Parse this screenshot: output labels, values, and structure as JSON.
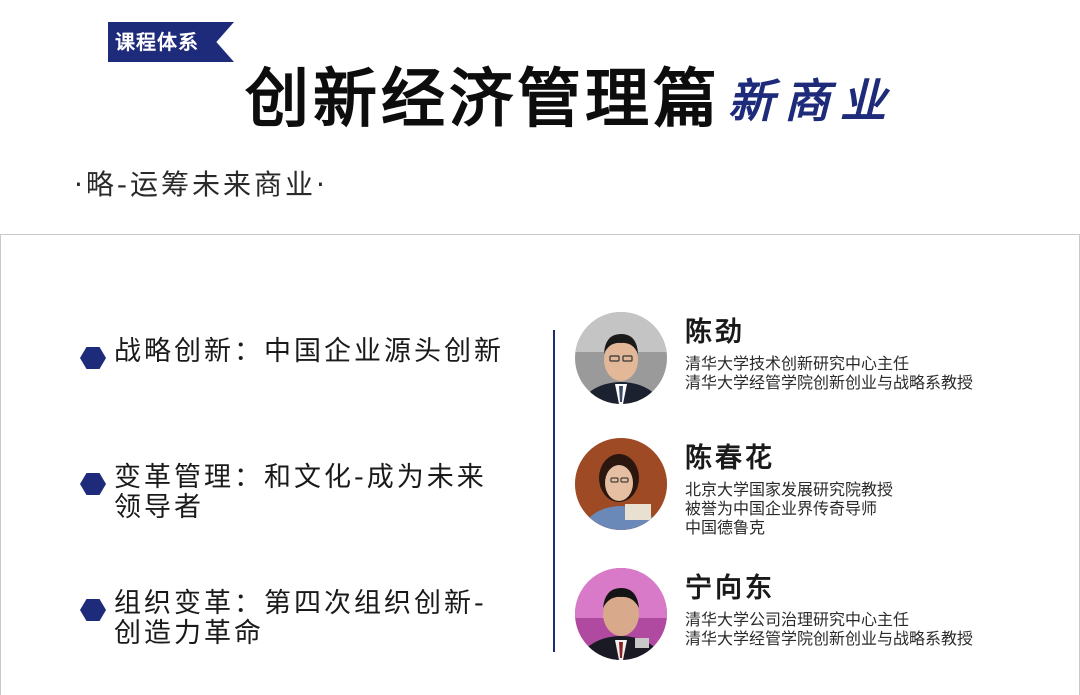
{
  "header": {
    "tag": "课程体系",
    "title": "创新经济管理篇",
    "calligraphy": "新商业",
    "subtitle": "·略-运筹未来商业·"
  },
  "topics": [
    {
      "lines": [
        "战略创新：中国企业源头创新"
      ]
    },
    {
      "lines": [
        "变革管理：和文化-成为未来",
        "领导者"
      ]
    },
    {
      "lines": [
        "组织变革：第四次组织创新-",
        "创造力革命"
      ]
    }
  ],
  "people": [
    {
      "name": "陈劲",
      "desc": [
        "清华大学技术创新研究中心主任",
        "清华大学经管学院创新创业与战略系教授"
      ]
    },
    {
      "name": "陈春花",
      "desc": [
        "北京大学国家发展研究院教授",
        "被誉为中国企业界传奇导师",
        "中国德鲁克"
      ]
    },
    {
      "name": "宁向东",
      "desc": [
        "清华大学公司治理研究中心主任",
        "清华大学经管学院创新创业与战略系教授"
      ]
    }
  ],
  "colors": {
    "accent": "#1e2a7a",
    "divider": "#c9c9c9"
  }
}
